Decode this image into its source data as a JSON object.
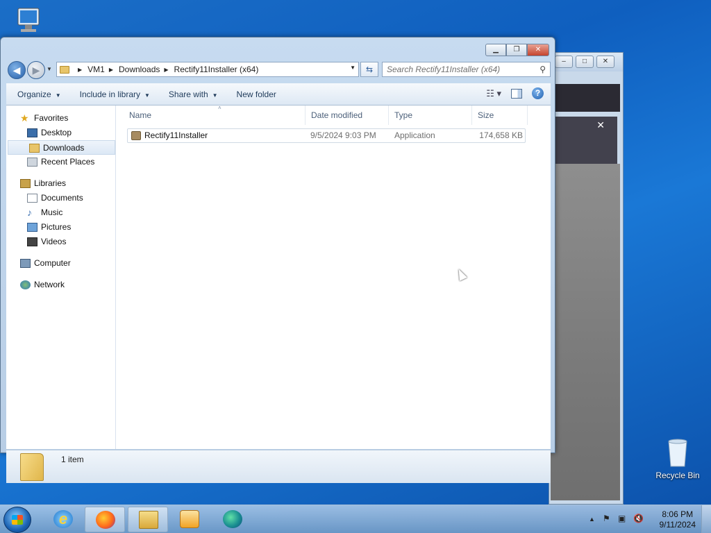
{
  "desktop": {
    "recycle_bin_label": "Recycle Bin"
  },
  "explorer": {
    "address": {
      "crumbs": [
        "VM1",
        "Downloads",
        "Rectify11Installer (x64)"
      ]
    },
    "search": {
      "placeholder": "Search Rectify11Installer (x64)"
    },
    "toolbar": {
      "organize": "Organize",
      "include_in_library": "Include in library",
      "share_with": "Share with",
      "new_folder": "New folder"
    },
    "navpane": {
      "favorites": "Favorites",
      "desktop": "Desktop",
      "downloads": "Downloads",
      "recent_places": "Recent Places",
      "libraries": "Libraries",
      "documents": "Documents",
      "music": "Music",
      "pictures": "Pictures",
      "videos": "Videos",
      "computer": "Computer",
      "network": "Network"
    },
    "columns": {
      "name": "Name",
      "date_modified": "Date modified",
      "type": "Type",
      "size": "Size"
    },
    "files": [
      {
        "name": "Rectify11Installer",
        "date_modified": "9/5/2024 9:03 PM",
        "type": "Application",
        "size": "174,658 KB"
      }
    ],
    "details": {
      "item_count": "1 item"
    }
  },
  "taskbar": {
    "time": "8:06 PM",
    "date": "9/11/2024"
  }
}
